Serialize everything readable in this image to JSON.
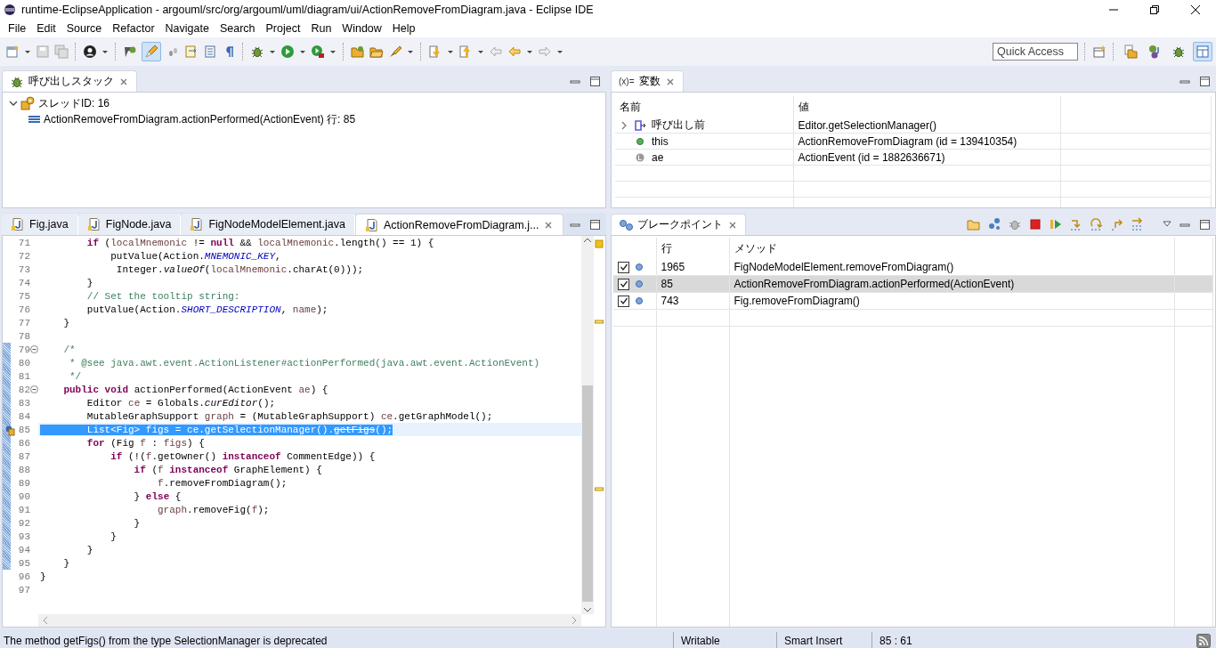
{
  "window": {
    "title": "runtime-EclipseApplication - argouml/src/org/argouml/uml/diagram/ui/ActionRemoveFromDiagram.java - Eclipse IDE"
  },
  "menu": [
    "File",
    "Edit",
    "Source",
    "Refactor",
    "Navigate",
    "Search",
    "Project",
    "Run",
    "Window",
    "Help"
  ],
  "toolbar": {
    "highlight_toggle": {
      "on": true
    },
    "quick_access": {
      "placeholder": "Quick Access"
    },
    "perspectives": [
      {
        "selected": false
      },
      {
        "selected": false
      },
      {
        "selected": false
      },
      {
        "selected": true
      }
    ]
  },
  "call_stack": {
    "tab": "呼び出しスタック",
    "tree": [
      {
        "label": "スレッドID: 16",
        "expanded": true,
        "children": [
          {
            "label": "ActionRemoveFromDiagram.actionPerformed(ActionEvent) 行: 85"
          }
        ]
      }
    ]
  },
  "variables": {
    "tab": "変数",
    "tab_prefix": "(x)=",
    "columns": [
      "名前",
      "値"
    ],
    "rows": [
      {
        "kind": "return",
        "expanded": false,
        "name": "呼び出し前",
        "value": "Editor.getSelectionManager()"
      },
      {
        "kind": "object",
        "name": "this",
        "value": "ActionRemoveFromDiagram (id = 139410354)"
      },
      {
        "kind": "local",
        "name": "ae",
        "value": "ActionEvent (id = 1882636671)"
      }
    ]
  },
  "editor": {
    "tabs": [
      {
        "label": "Fig.java",
        "selected": false
      },
      {
        "label": "FigNode.java",
        "selected": false
      },
      {
        "label": "FigNodeModelElement.java",
        "selected": false
      },
      {
        "label": "ActionRemoveFromDiagram.j...",
        "selected": true
      }
    ],
    "lines": [
      {
        "number": "71",
        "tokens": [
          {
            "kind": "keyword",
            "text": "        if"
          },
          {
            "kind": "plain",
            "text": " ("
          },
          {
            "kind": "local",
            "text": "localMnemonic"
          },
          {
            "kind": "plain",
            "text": " != "
          },
          {
            "kind": "keyword",
            "text": "null"
          },
          {
            "kind": "plain",
            "text": " && "
          },
          {
            "kind": "local",
            "text": "localMnemonic"
          },
          {
            "kind": "plain",
            "text": ".length() == 1) {"
          }
        ]
      },
      {
        "number": "72",
        "tokens": [
          {
            "kind": "plain",
            "text": "            putValue(Action."
          },
          {
            "kind": "field",
            "text": "MNEMONIC_KEY"
          },
          {
            "kind": "plain",
            "text": ","
          }
        ]
      },
      {
        "number": "73",
        "tokens": [
          {
            "kind": "plain",
            "text": "             Integer."
          },
          {
            "kind": "static",
            "text": "valueOf"
          },
          {
            "kind": "plain",
            "text": "("
          },
          {
            "kind": "local",
            "text": "localMnemonic"
          },
          {
            "kind": "plain",
            "text": ".charAt(0)));"
          }
        ]
      },
      {
        "number": "74",
        "tokens": [
          {
            "kind": "plain",
            "text": "        }"
          }
        ]
      },
      {
        "number": "75",
        "tokens": [
          {
            "kind": "comment",
            "text": "        // Set the tooltip string:"
          }
        ]
      },
      {
        "number": "76",
        "tokens": [
          {
            "kind": "plain",
            "text": "        putValue(Action."
          },
          {
            "kind": "field",
            "text": "SHORT_DESCRIPTION"
          },
          {
            "kind": "plain",
            "text": ", "
          },
          {
            "kind": "local",
            "text": "name"
          },
          {
            "kind": "plain",
            "text": ");"
          }
        ]
      },
      {
        "number": "77",
        "tokens": [
          {
            "kind": "plain",
            "text": "    }"
          }
        ]
      },
      {
        "number": "78"
      },
      {
        "number": "79",
        "changed": true,
        "expanded": true,
        "tokens": [
          {
            "kind": "comment",
            "text": "    /*"
          }
        ]
      },
      {
        "number": "80",
        "changed": true,
        "tokens": [
          {
            "kind": "comment",
            "text": "     * @see java.awt.event.ActionListener#actionPerformed(java.awt.event.ActionEvent)"
          }
        ]
      },
      {
        "number": "81",
        "changed": true,
        "tokens": [
          {
            "kind": "comment",
            "text": "     */"
          }
        ]
      },
      {
        "number": "82",
        "changed": true,
        "expanded": true,
        "tokens": [
          {
            "kind": "keyword",
            "text": "    public void"
          },
          {
            "kind": "plain",
            "text": " actionPerformed(ActionEvent "
          },
          {
            "kind": "local",
            "text": "ae"
          },
          {
            "kind": "plain",
            "text": ") {"
          }
        ]
      },
      {
        "number": "83",
        "changed": true,
        "tokens": [
          {
            "kind": "plain",
            "text": "        Editor "
          },
          {
            "kind": "local",
            "text": "ce"
          },
          {
            "kind": "plain",
            "text": " = Globals."
          },
          {
            "kind": "static",
            "text": "curEditor"
          },
          {
            "kind": "plain",
            "text": "();"
          }
        ]
      },
      {
        "number": "84",
        "changed": true,
        "tokens": [
          {
            "kind": "plain",
            "text": "        MutableGraphSupport "
          },
          {
            "kind": "local",
            "text": "graph"
          },
          {
            "kind": "plain",
            "text": " = (MutableGraphSupport) "
          },
          {
            "kind": "local",
            "text": "ce"
          },
          {
            "kind": "plain",
            "text": ".getGraphModel();"
          }
        ]
      },
      {
        "number": "85",
        "changed": true,
        "selected": true,
        "breakpoint": true,
        "tokens": [
          {
            "kind": "plain",
            "text": "        List<Fig> figs = ce.getSelectionManager()."
          },
          {
            "kind": "deprecated",
            "text": "getFigs"
          },
          {
            "kind": "plain",
            "text": "();"
          }
        ]
      },
      {
        "number": "86",
        "changed": true,
        "tokens": [
          {
            "kind": "keyword",
            "text": "        for"
          },
          {
            "kind": "plain",
            "text": " (Fig "
          },
          {
            "kind": "local",
            "text": "f"
          },
          {
            "kind": "plain",
            "text": " : "
          },
          {
            "kind": "local",
            "text": "figs"
          },
          {
            "kind": "plain",
            "text": ") {"
          }
        ]
      },
      {
        "number": "87",
        "changed": true,
        "tokens": [
          {
            "kind": "keyword",
            "text": "            if"
          },
          {
            "kind": "plain",
            "text": " (!("
          },
          {
            "kind": "local",
            "text": "f"
          },
          {
            "kind": "plain",
            "text": ".getOwner() "
          },
          {
            "kind": "keyword",
            "text": "instanceof"
          },
          {
            "kind": "plain",
            "text": " CommentEdge)) {"
          }
        ]
      },
      {
        "number": "88",
        "changed": true,
        "tokens": [
          {
            "kind": "keyword",
            "text": "                if"
          },
          {
            "kind": "plain",
            "text": " ("
          },
          {
            "kind": "local",
            "text": "f"
          },
          {
            "kind": "keyword",
            "text": " instanceof"
          },
          {
            "kind": "plain",
            "text": " GraphElement) {"
          }
        ]
      },
      {
        "number": "89",
        "changed": true,
        "tokens": [
          {
            "kind": "local",
            "text": "                    f"
          },
          {
            "kind": "plain",
            "text": ".removeFromDiagram();"
          }
        ]
      },
      {
        "number": "90",
        "changed": true,
        "tokens": [
          {
            "kind": "plain",
            "text": "                } "
          },
          {
            "kind": "keyword",
            "text": "else"
          },
          {
            "kind": "plain",
            "text": " {"
          }
        ]
      },
      {
        "number": "91",
        "changed": true,
        "tokens": [
          {
            "kind": "local",
            "text": "                    graph"
          },
          {
            "kind": "plain",
            "text": ".removeFig("
          },
          {
            "kind": "local",
            "text": "f"
          },
          {
            "kind": "plain",
            "text": ");"
          }
        ]
      },
      {
        "number": "92",
        "changed": true,
        "tokens": [
          {
            "kind": "plain",
            "text": "                }"
          }
        ]
      },
      {
        "number": "93",
        "changed": true,
        "tokens": [
          {
            "kind": "plain",
            "text": "            }"
          }
        ]
      },
      {
        "number": "94",
        "changed": true,
        "tokens": [
          {
            "kind": "plain",
            "text": "        }"
          }
        ]
      },
      {
        "number": "95",
        "changed": true,
        "tokens": [
          {
            "kind": "plain",
            "text": "    }"
          }
        ]
      },
      {
        "number": "96",
        "tokens": [
          {
            "kind": "plain",
            "text": "}"
          }
        ]
      },
      {
        "number": "97"
      }
    ]
  },
  "breakpoints": {
    "tab": "ブレークポイント",
    "columns": [
      "行",
      "メソッド"
    ],
    "rows": [
      {
        "checked": true,
        "selected": false,
        "line": "1965",
        "method": "FigNodeModelElement.removeFromDiagram()"
      },
      {
        "checked": true,
        "selected": true,
        "line": "85",
        "method": "ActionRemoveFromDiagram.actionPerformed(ActionEvent)"
      },
      {
        "checked": true,
        "selected": false,
        "line": "743",
        "method": "Fig.removeFromDiagram()"
      }
    ]
  },
  "status_bar": {
    "message": "The method getFigs() from the type SelectionManager is deprecated",
    "sections": [
      "Writable",
      "Smart Insert",
      "85 : 61"
    ]
  }
}
